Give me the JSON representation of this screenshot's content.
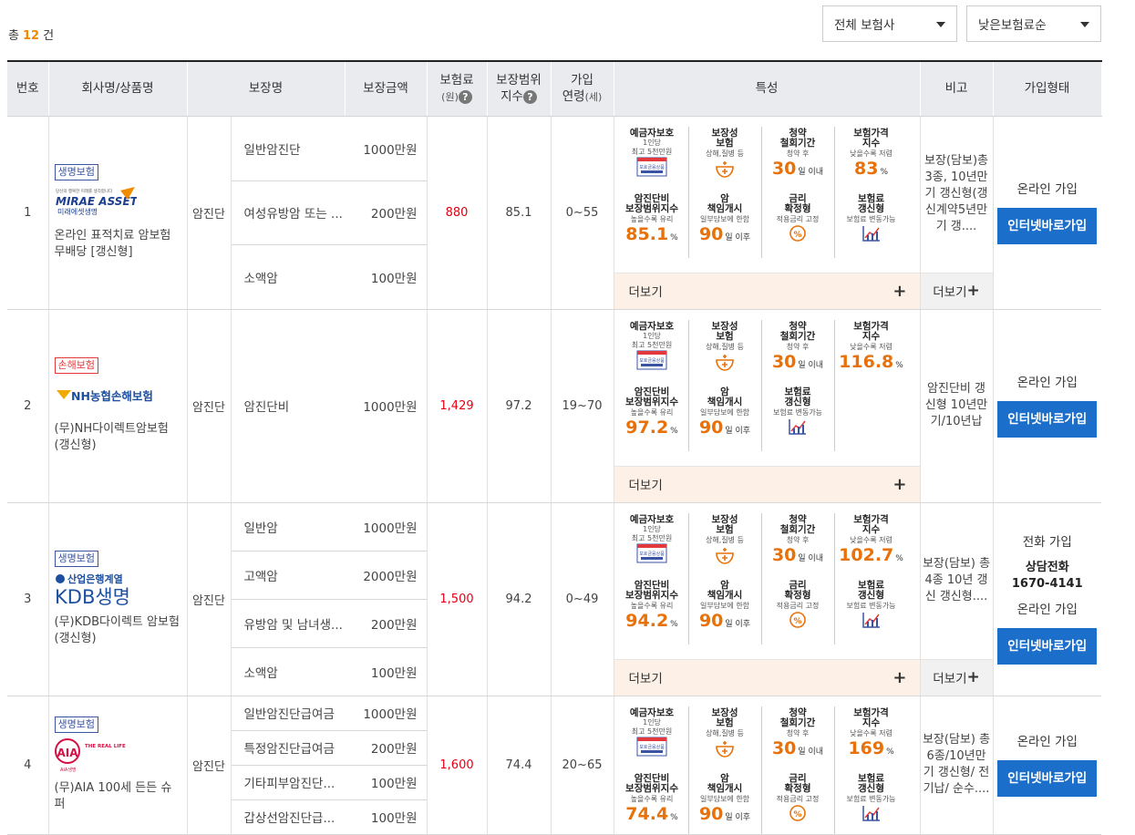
{
  "summary": {
    "prefix": "총",
    "count": "12",
    "suffix": "건"
  },
  "filters": {
    "insurer": "전체 보험사",
    "sort": "낮은보험료순"
  },
  "headers": {
    "num": "번호",
    "company": "회사명/상품명",
    "coverage": "보장명",
    "amount": "보장금액",
    "premium": "보험료",
    "premium_unit": "(원)",
    "scope1": "보장범위",
    "scope2": "지수",
    "age1": "가입",
    "age2": "연령",
    "age_unit": "(세)",
    "features": "특성",
    "note": "비고",
    "join": "가입형태"
  },
  "feature_labels": {
    "deposit": {
      "title": "예금자보호",
      "sub1": "1인당",
      "sub2": "최고 5천만원"
    },
    "protect": {
      "title1": "보장성",
      "title2": "보험",
      "sub": "상해,질병 등"
    },
    "withdraw": {
      "title1": "청약",
      "title2": "철회기간",
      "sub": "청약 후",
      "unit": "일 이내"
    },
    "price": {
      "title1": "보험가격",
      "title2": "지수",
      "sub": "낮을수록 저렴",
      "unit": "%"
    },
    "scope": {
      "title1": "암진단비",
      "title2": "보장범위지수",
      "sub": "높을수록 유리",
      "unit": "%"
    },
    "start": {
      "title1": "암",
      "title2": "책임개시",
      "sub": "일부담보에 한함",
      "unit": "일 이후"
    },
    "rate": {
      "title1": "금리",
      "title2": "확정형",
      "sub": "적용금리 고정"
    },
    "renew": {
      "title1": "보험료",
      "title2": "갱신형",
      "sub": "보험료 변동가능"
    }
  },
  "more_label": "더보기",
  "join_online": "온라인 가입",
  "join_button": "인터넷바로가입",
  "rows": [
    {
      "num": "1",
      "type": "생명보험",
      "logo": "MIRAE ASSET",
      "logo_sub": "미래에셋생명",
      "logo_tag": "당신의 행복한 미래를 생각합니다",
      "product": "온라인 표적치료 암보험 무배당 [갱신형]",
      "category": "암진단",
      "coverages": [
        {
          "name": "일반암진단",
          "amount": "1000만원"
        },
        {
          "name": "여성유방암 또는 ...",
          "amount": "200만원"
        },
        {
          "name": "소액암",
          "amount": "100만원"
        }
      ],
      "premium": "880",
      "scope": "85.1",
      "age": "0~55",
      "features": {
        "withdraw_days": "30",
        "price_index": "83",
        "scope_index": "85.1",
        "start_days": "90"
      },
      "note": "보장(담보)총3종, 10년만기 갱신형(갱신계약5년만기 갱....",
      "join_text": "온라인 가입"
    },
    {
      "num": "2",
      "type": "손해보험",
      "logo": "NH농협손해보험",
      "product": "(무)NH다이렉트암보험(갱신형)",
      "category": "암진단",
      "coverages": [
        {
          "name": "암진단비",
          "amount": "1000만원"
        }
      ],
      "premium": "1,429",
      "scope": "97.2",
      "age": "19~70",
      "features": {
        "withdraw_days": "30",
        "price_index": "116.8",
        "scope_index": "97.2",
        "start_days": "90"
      },
      "note": "암진단비 갱신형 10년만기/10년납",
      "join_text": "온라인 가입"
    },
    {
      "num": "3",
      "type": "생명보험",
      "logo": "KDB생명",
      "logo_top": "산업은행계열",
      "product": "(무)KDB다이렉트 암보험(갱신형)",
      "category": "암진단",
      "coverages": [
        {
          "name": "일반암",
          "amount": "1000만원"
        },
        {
          "name": "고액암",
          "amount": "2000만원"
        },
        {
          "name": "유방암 및 남녀생...",
          "amount": "200만원"
        },
        {
          "name": "소액암",
          "amount": "100만원"
        }
      ],
      "premium": "1,500",
      "scope": "94.2",
      "age": "0~49",
      "features": {
        "withdraw_days": "30",
        "price_index": "102.7",
        "scope_index": "94.2",
        "start_days": "90"
      },
      "note": "보장(담보) 총 4종 10년 갱신 갱신형....",
      "join_phone_label": "전화 가입",
      "join_phone_title": "상담전화",
      "join_phone": "1670-4141",
      "join_text": "온라인 가입"
    },
    {
      "num": "4",
      "type": "생명보험",
      "logo": "AIA",
      "logo_sub": "AIA생명",
      "logo_tag": "THE REAL LIFE COMPANY",
      "product": "(무)AIA 100세 든든 슈퍼",
      "category": "암진단",
      "coverages": [
        {
          "name": "일반암진단급여금",
          "amount": "1000만원"
        },
        {
          "name": "특정암진단급여금",
          "amount": "200만원"
        },
        {
          "name": "기타피부암진단...",
          "amount": "100만원"
        },
        {
          "name": "갑상선암진단급...",
          "amount": "100만원"
        }
      ],
      "premium": "1,600",
      "scope": "74.4",
      "age": "20~65",
      "features": {
        "withdraw_days": "30",
        "price_index": "169",
        "scope_index": "74.4",
        "start_days": "90"
      },
      "note": "보장(담보) 총 6종/10년만기 갱신형/ 전기납/ 순수....",
      "join_text": "온라인 가입"
    }
  ],
  "colors": {
    "accent_orange": "#e8710a",
    "premium_red": "#e60012",
    "join_blue": "#1c6ecb",
    "more_bg": "#fdf1e7",
    "header_bg": "#e9ebef"
  }
}
